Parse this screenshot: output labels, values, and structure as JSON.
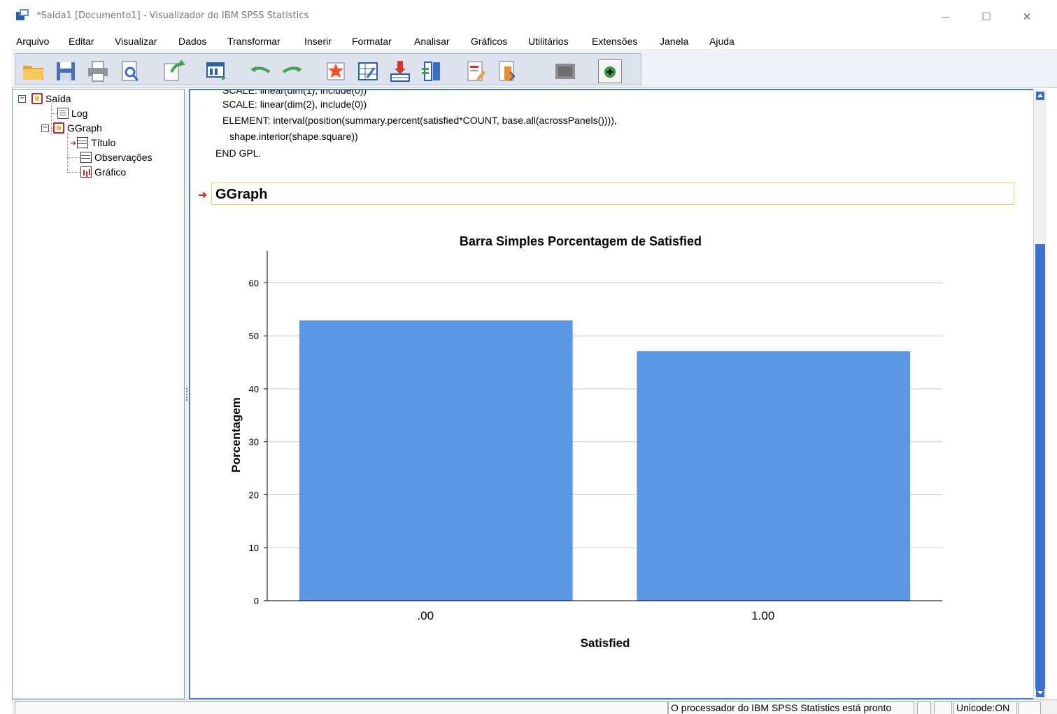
{
  "window": {
    "title": "*Saída1 [Documento1] - Visualizador do IBM SPSS Statistics",
    "minimize_icon": "minimize-icon",
    "maximize_icon": "maximize-icon",
    "close_icon": "close-icon",
    "minimize_glyph": "—",
    "maximize_glyph": "☐",
    "close_glyph": "✕"
  },
  "menu": {
    "items": [
      "Arquivo",
      "Editar",
      "Visualizar",
      "Dados",
      "Transformar",
      "Inserir",
      "Formatar",
      "Analisar",
      "Gráficos",
      "Utilitários",
      "Extensões",
      "Janela",
      "Ajuda"
    ]
  },
  "toolbar": {
    "icons": [
      "open-folder-icon",
      "save-icon",
      "print-icon",
      "print-preview-icon",
      "export-icon",
      "recall-dialog-icon",
      "undo-icon",
      "redo-icon",
      "goto-data-icon",
      "goto-case-icon",
      "variables-icon",
      "select-output-icon",
      "new-title-icon",
      "new-text-icon",
      "collapse-icon",
      "show-icon"
    ]
  },
  "tree": {
    "items": [
      {
        "label": "Saída",
        "icon": "output-book-icon",
        "expander": "−"
      },
      {
        "label": "Log",
        "icon": "log-icon"
      },
      {
        "label": "GGraph",
        "icon": "ggraph-book-icon",
        "expander": "−"
      },
      {
        "label": "Título",
        "icon": "title-icon",
        "marker": "current-item-arrow-icon"
      },
      {
        "label": "Observações",
        "icon": "notes-icon"
      },
      {
        "label": "Gráfico",
        "icon": "chart-icon"
      }
    ]
  },
  "content": {
    "syntax_lines": [
      "SCALE: linear(dim(2), include(0))",
      "ELEMENT: interval(position(summary.percent(satisfied*COUNT, base.all(acrossPanels()))),",
      "shape.interior(shape.square))",
      "END GPL."
    ],
    "heading": "GGraph",
    "heading_marker": "➜"
  },
  "chart_data": {
    "type": "bar",
    "title": "Barra Simples Porcentagem de Satisfied",
    "xlabel": "Satisfied",
    "ylabel": "Porcentagem",
    "categories": [
      ".00",
      "1.00"
    ],
    "values": [
      52.9,
      47.1
    ],
    "ylim": [
      0,
      60
    ],
    "yticks": [
      0,
      10,
      20,
      30,
      40,
      50,
      60
    ],
    "ytick_labels": [
      "0",
      "10",
      "20",
      "30",
      "40",
      "50",
      "60"
    ],
    "grid": true,
    "bar_color": "#5b97e3"
  },
  "status": {
    "message": "O processador do IBM SPSS Statistics  está pronto",
    "unicode": "Unicode:ON"
  }
}
